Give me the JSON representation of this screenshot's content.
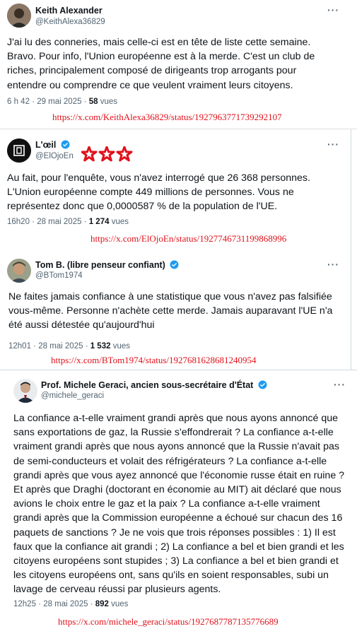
{
  "tweets": [
    {
      "name": "Keith Alexander",
      "handle": "@KeithAlexa36829",
      "text": "J'ai lu des conneries, mais celle-ci est en tête de liste cette semaine. Bravo. Pour info, l'Union européenne est à la merde. C'est un club de riches, principalement composé de dirigeants trop arrogants pour entendre ou comprendre ce que veulent vraiment leurs citoyens.",
      "time": "6 h 42 · 29 mai 2025 · ",
      "views": "58",
      "views_label": " vues",
      "url": "https://x.com/KeithAlexa36829/status/1927963771739292107"
    },
    {
      "name": "L'œil",
      "handle": "@ElOjoEn",
      "text": "Au fait, pour l'enquête, vous n'avez interrogé que 26 368 personnes. L'Union européenne compte 449 millions de personnes. Vous ne représentez donc que 0,0000587 % de la population de l'UE.",
      "time": "16h20 · 28 mai 2025 · ",
      "views": "1 274",
      "views_label": " vues",
      "url": "https://x.com/ElOjoEn/status/1927746731199868996"
    },
    {
      "name": "Tom B. (libre penseur confiant)",
      "handle": "@BTom1974",
      "text": "Ne faites jamais confiance à une statistique que vous n'avez pas falsifiée vous-même. Personne n'achète cette merde. Jamais auparavant l'UE n'a été aussi détestée qu'aujourd'hui",
      "time": "12h01 · 28 mai 2025 · ",
      "views": "1 532",
      "views_label": " vues",
      "url": "https://x.com/BTom1974/status/1927681628681240954"
    },
    {
      "name": "Prof. Michele Geraci, ancien sous-secrétaire d'État",
      "handle": "@michele_geraci",
      "text": "La confiance a-t-elle vraiment grandi après que nous ayons annoncé que sans exportations de gaz, la Russie s'effondrerait ? La confiance a-t-elle vraiment grandi après que nous ayons annoncé que la Russie n'avait pas de semi-conducteurs et volait des réfrigérateurs ? La confiance a-t-elle grandi après que vous ayez annoncé que l'économie russe était en ruine ? Et après que Draghi (doctorant en économie au MIT) ait déclaré que nous avions le choix entre le gaz et la paix ? La confiance a-t-elle vraiment grandi après que la Commission européenne a échoué sur chacun des 16 paquets de sanctions ? Je ne vois que trois réponses possibles : 1) Il est faux que la confiance ait grandi ; 2) La confiance a bel et bien grandi et les citoyens européens sont stupides ; 3) La confiance a bel et bien grandi et les citoyens européens ont, sans qu'ils en soient responsables, subi un lavage de cerveau réussi par plusieurs agents.",
      "time": "12h25 · 28 mai 2025 · ",
      "views": "892",
      "views_label": " vues",
      "url": "https://x.com/michele_geraci/status/1927687787135776689"
    }
  ],
  "more_glyph": "···",
  "colors": {
    "verified": "#1d9bf0",
    "url": "#e0111b",
    "star": "#e0111b"
  }
}
